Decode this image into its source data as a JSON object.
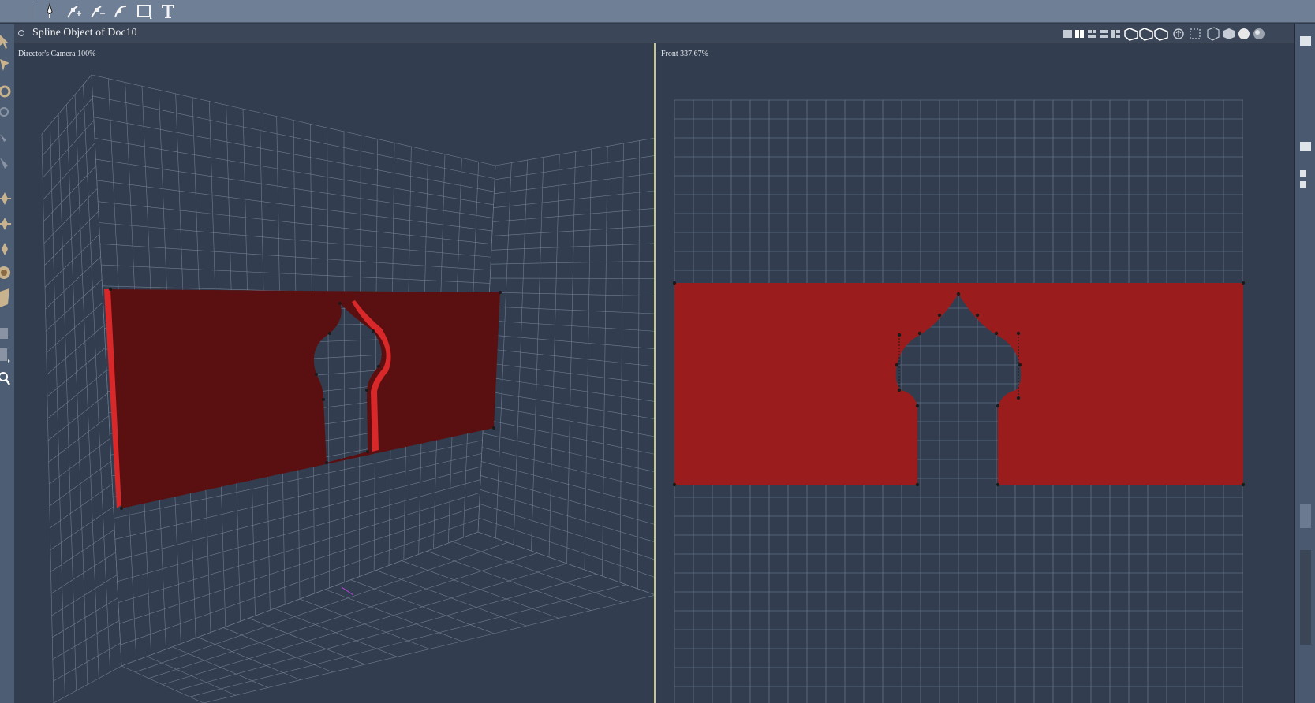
{
  "toolbar": {
    "tools": [
      "pen-tool",
      "add-point-tool",
      "remove-point-tool",
      "convert-point-tool",
      "rectangle-tool",
      "text-tool"
    ]
  },
  "document": {
    "title": "Spline Object of Doc10"
  },
  "viewports": {
    "left": {
      "label": "Director's Camera 100%"
    },
    "right": {
      "label": "Front 337.67%"
    }
  },
  "colors": {
    "object_front": "#9b1c1c",
    "object_side": "#d8282a",
    "object_dark": "#5a1010",
    "grid": "#7f8ba0",
    "viewport_bg": "#323e50",
    "active_border": "#c9c58e"
  },
  "view_controls": [
    "single-view",
    "dual-view",
    "quad-view",
    "four-view",
    "three-view",
    "render-style-1",
    "render-style-2",
    "render-style-3",
    "rotate-view",
    "move-view",
    "zoom-view",
    "wireframe-style",
    "shaded-style",
    "smooth-style",
    "texture-style"
  ]
}
